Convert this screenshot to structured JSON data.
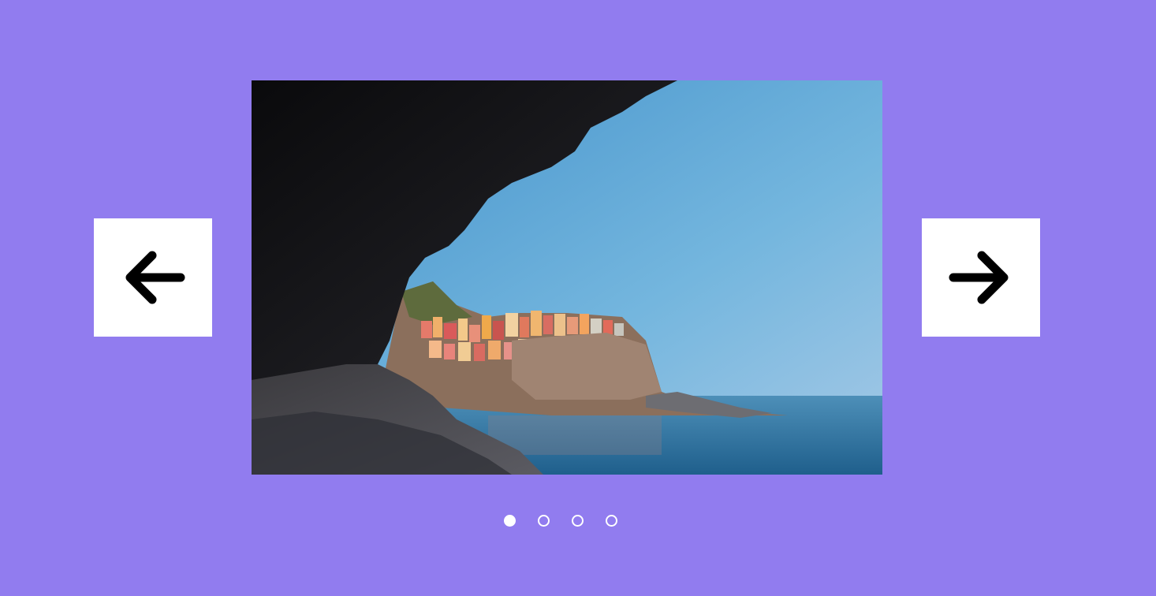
{
  "colors": {
    "background": "#917cef",
    "button_bg": "#ffffff",
    "arrow": "#000000",
    "dot": "#ffffff"
  },
  "carousel": {
    "prev_icon": "arrow-left-icon",
    "next_icon": "arrow-right-icon",
    "slide_count": 4,
    "active_index": 0,
    "current_slide": {
      "depicts": "coastal-cliff-village-seascape"
    }
  }
}
